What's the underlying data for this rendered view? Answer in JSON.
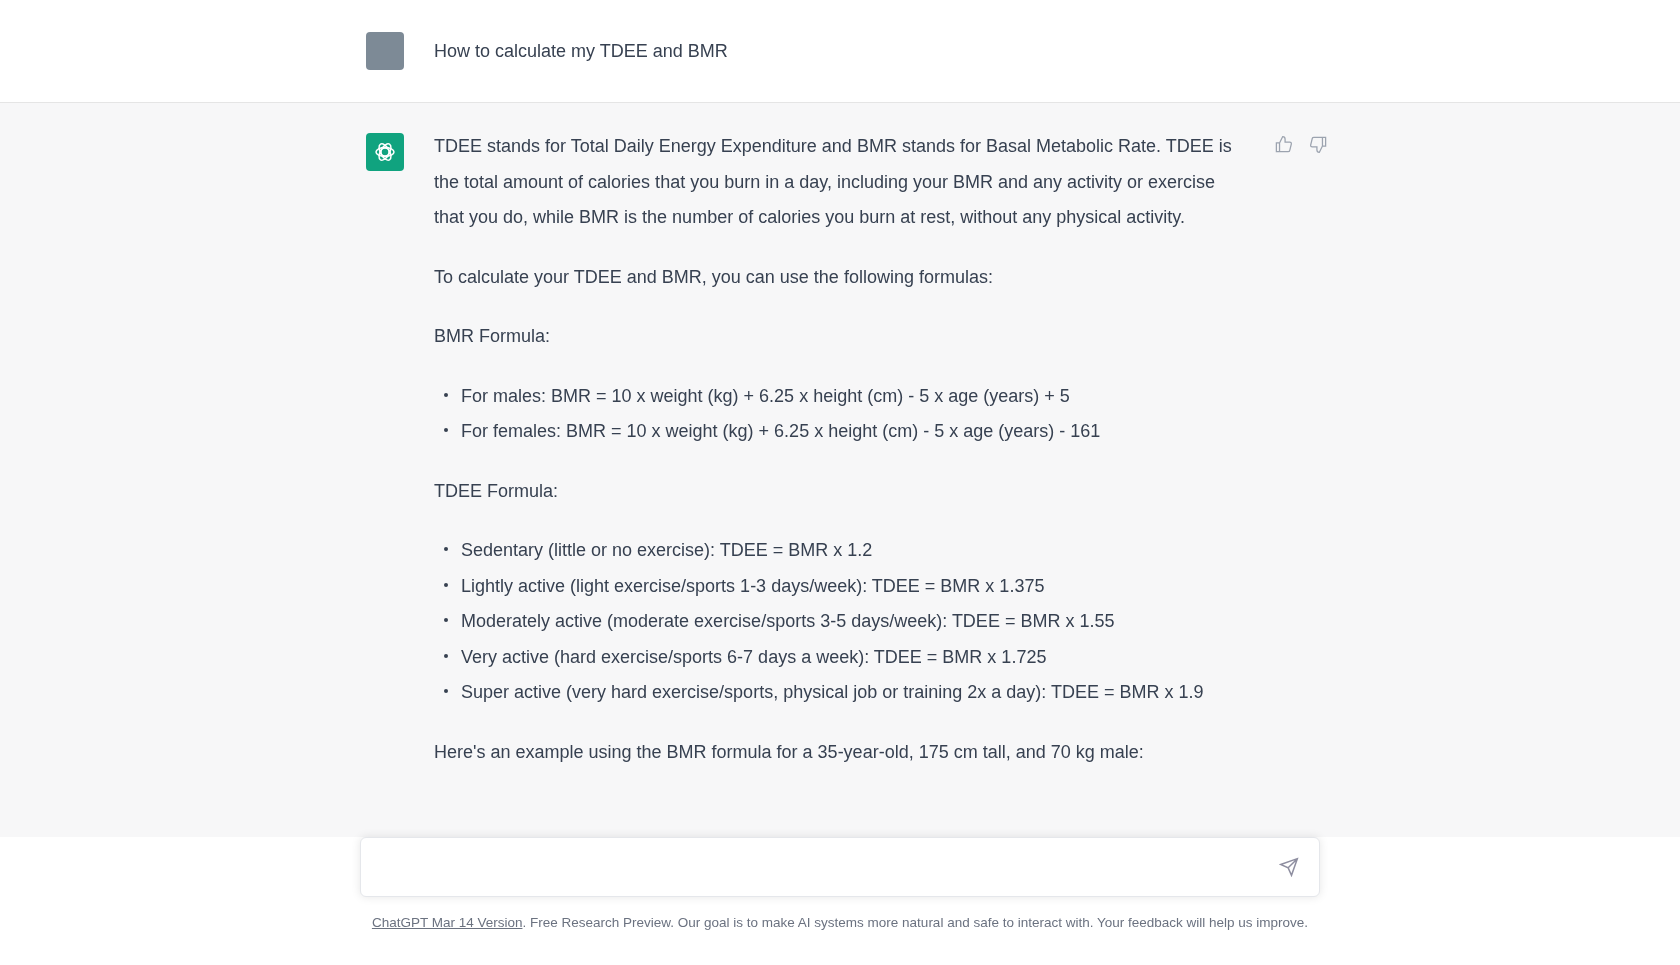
{
  "question": {
    "text": "How to calculate my TDEE and BMR"
  },
  "answer": {
    "blocks": [
      {
        "kind": "paragraph",
        "text": "TDEE stands for Total Daily Energy Expenditure and BMR stands for Basal Metabolic Rate. TDEE is the total amount of calories that you burn in a day, including your BMR and any activity or exercise that you do, while BMR is the number of calories you burn at rest, without any physical activity."
      },
      {
        "kind": "paragraph",
        "text": "To calculate your TDEE and BMR, you can use the following formulas:"
      },
      {
        "kind": "paragraph",
        "text": "BMR Formula:"
      },
      {
        "kind": "list",
        "items": [
          "For males: BMR = 10 x weight (kg) + 6.25 x height (cm) - 5 x age (years) + 5",
          "For females: BMR = 10 x weight (kg) + 6.25 x height (cm) - 5 x age (years) - 161"
        ]
      },
      {
        "kind": "paragraph",
        "text": "TDEE Formula:"
      },
      {
        "kind": "list",
        "items": [
          "Sedentary (little or no exercise): TDEE = BMR x 1.2",
          "Lightly active (light exercise/sports 1-3 days/week): TDEE = BMR x 1.375",
          "Moderately active (moderate exercise/sports 3-5 days/week): TDEE = BMR x 1.55",
          "Very active (hard exercise/sports 6-7 days a week): TDEE = BMR x 1.725",
          "Super active (very hard exercise/sports, physical job or training 2x a day): TDEE = BMR x 1.9"
        ]
      },
      {
        "kind": "paragraph",
        "text": "Here's an example using the BMR formula for a 35-year-old, 175 cm tall, and 70 kg male:"
      }
    ]
  },
  "footer": {
    "link": "ChatGPT Mar 14 Version",
    "text": ". Free Research Preview. Our goal is to make AI systems more natural and safe to interact with. Your feedback will help us improve."
  }
}
